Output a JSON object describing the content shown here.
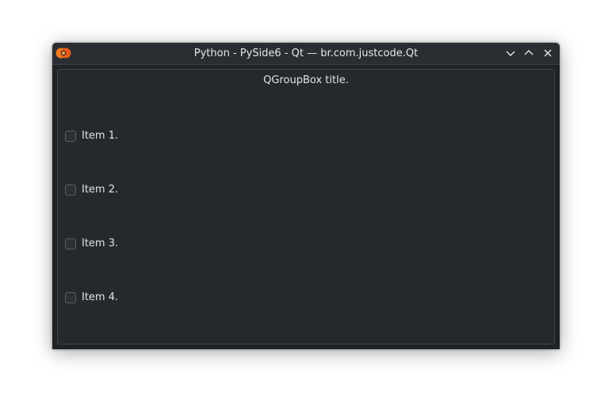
{
  "window": {
    "title": "Python - PySide6 - Qt — br.com.justcode.Qt",
    "app_icon": "python-logo-icon",
    "controls": {
      "minimize_icon": "chevron-down-icon",
      "maximize_icon": "chevron-up-icon",
      "close_icon": "close-icon"
    }
  },
  "groupbox": {
    "title": "QGroupBox title.",
    "items": [
      {
        "label": "Item 1.",
        "checked": false
      },
      {
        "label": "Item 2.",
        "checked": false
      },
      {
        "label": "Item 3.",
        "checked": false
      },
      {
        "label": "Item 4.",
        "checked": false
      }
    ]
  },
  "colors": {
    "titlebar": "#2a2e32",
    "background": "#25292d",
    "text": "#e3e3e3",
    "app_icon_accent": "#f47a20"
  }
}
